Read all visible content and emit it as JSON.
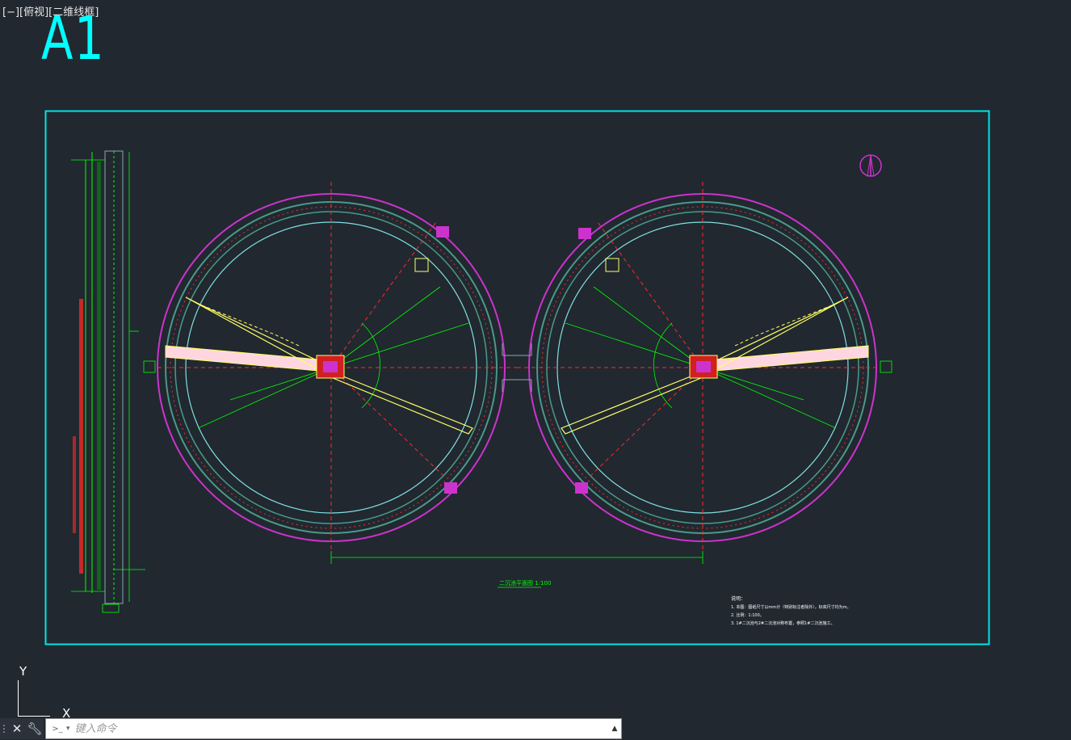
{
  "viewport": {
    "label": "[−][俯视][二维线框]"
  },
  "sheet": {
    "size_label": "A1",
    "frame_color": "#00e5e5"
  },
  "colors": {
    "magenta": "#cc33cc",
    "green": "#00ff00",
    "red": "#ff2a2a",
    "yellow": "#ffff66",
    "cyan": "#00e5e5",
    "ring": "#4a9a8a",
    "white": "#ffffff"
  },
  "drawing": {
    "title": "二沉池平面图 1:100",
    "notes": {
      "heading": "说明：",
      "lines": [
        "1. 本图：图纸尺寸以mm计（特别标注者除外），标高尺寸均为m。",
        "2. 比例：1:100。",
        "3. 1#二沉池与2#二沉池对称布置，参照1#二沉池施工。"
      ]
    }
  },
  "ucs": {
    "y_label": "Y",
    "x_label": "X"
  },
  "command_line": {
    "grip_icon": "grip-icon",
    "close_icon": "close-icon",
    "settings_icon": "wrench-icon",
    "prompt_icon": "prompt-icon",
    "placeholder": "键入命令",
    "scroll_icon": "scroll-up-icon"
  }
}
